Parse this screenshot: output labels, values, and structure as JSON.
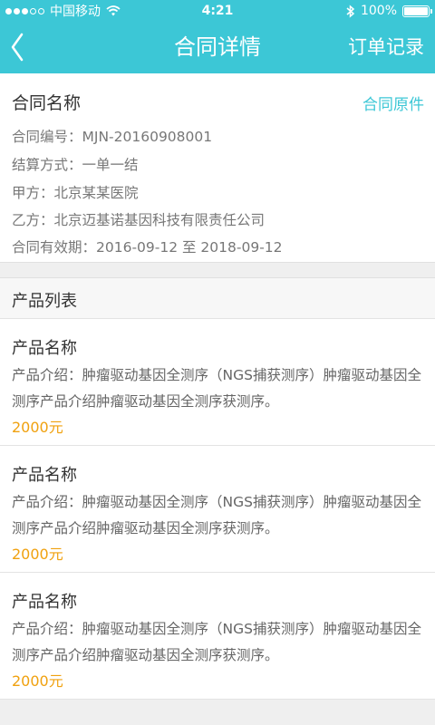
{
  "status_bar": {
    "carrier": "中国移动",
    "time": "4:21",
    "battery": "100%",
    "signal_bars_filled": 3,
    "signal_bars_total": 5,
    "battery_level": 1.0
  },
  "nav": {
    "title": "合同详情",
    "right_action": "订单记录",
    "back_icon": "chevron-left-icon"
  },
  "contract": {
    "name": "合同名称",
    "original_link": "合同原件",
    "lines": [
      "合同编号：MJN-20160908001",
      "结算方式：一单一结",
      "甲方：北京某某医院",
      "乙方：北京迈基诺基因科技有限责任公司",
      "合同有效期：2016-09-12 至 2018-09-12"
    ]
  },
  "products": {
    "section_title": "产品列表",
    "items": [
      {
        "name": "产品名称",
        "description": "产品介绍：肿瘤驱动基因全测序（NGS捕获测序）肿瘤驱动基因全测序产品介绍肿瘤驱动基因全测序获测序。",
        "price": "2000元"
      },
      {
        "name": "产品名称",
        "description": "产品介绍：肿瘤驱动基因全测序（NGS捕获测序）肿瘤驱动基因全测序产品介绍肿瘤驱动基因全测序获测序。",
        "price": "2000元"
      },
      {
        "name": "产品名称",
        "description": "产品介绍：肿瘤驱动基因全测序（NGS捕获测序）肿瘤驱动基因全测序产品介绍肿瘤驱动基因全测序获测序。",
        "price": "2000元"
      }
    ]
  },
  "colors": {
    "primary": "#3cc7d6",
    "price": "#f0a10f",
    "background": "#efefef"
  }
}
